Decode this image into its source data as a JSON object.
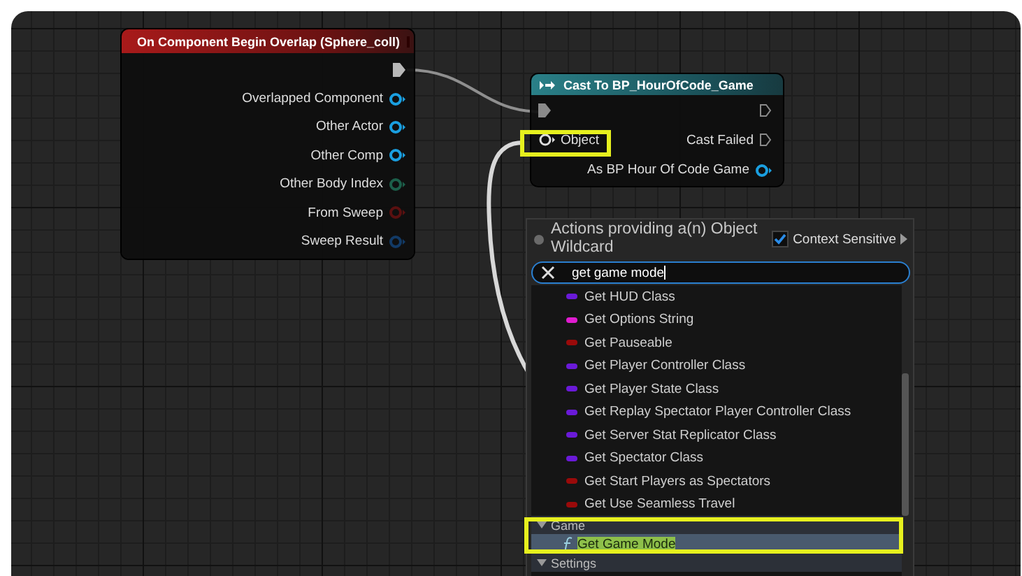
{
  "event_node": {
    "title": "On Component Begin Overlap (Sphere_coll)",
    "pins": [
      {
        "label": "Overlapped Component",
        "color": "#1a9fe0",
        "connected": false
      },
      {
        "label": "Other Actor",
        "color": "#1a9fe0",
        "connected": false
      },
      {
        "label": "Other Comp",
        "color": "#1a9fe0",
        "connected": false
      },
      {
        "label": "Other Body Index",
        "color": "#1c5f4a",
        "connected": false
      },
      {
        "label": "From Sweep",
        "color": "#5a1010",
        "connected": false
      },
      {
        "label": "Sweep Result",
        "color": "#123a66",
        "connected": false
      }
    ]
  },
  "cast_node": {
    "title": "Cast To BP_HourOfCode_Game",
    "input_pin": {
      "label": "Object",
      "connected": true
    },
    "outputs": [
      {
        "label": "Cast Failed",
        "kind": "exec"
      },
      {
        "label": "As BP Hour Of Code Game",
        "kind": "object"
      }
    ]
  },
  "action_menu": {
    "title": "Actions providing a(n) Object Wildcard",
    "context_sensitive": {
      "label": "Context Sensitive",
      "checked": true
    },
    "search": {
      "value": "get game mode"
    },
    "items": [
      {
        "label": "Get HUD Class",
        "color": "#6a1ad8"
      },
      {
        "label": "Get Options String",
        "color": "#e01cd0"
      },
      {
        "label": "Get Pauseable",
        "color": "#9a0a0a"
      },
      {
        "label": "Get Player Controller Class",
        "color": "#6a1ad8"
      },
      {
        "label": "Get Player State Class",
        "color": "#6a1ad8"
      },
      {
        "label": "Get Replay Spectator Player Controller Class",
        "color": "#6a1ad8"
      },
      {
        "label": "Get Server Stat Replicator Class",
        "color": "#6a1ad8"
      },
      {
        "label": "Get Spectator Class",
        "color": "#6a1ad8"
      },
      {
        "label": "Get Start Players as Spectators",
        "color": "#9a0a0a"
      },
      {
        "label": "Get Use Seamless Travel",
        "color": "#9a0a0a"
      }
    ],
    "categories": [
      {
        "label": "Game",
        "expanded": true,
        "items": [
          {
            "label": "Get Game Mode",
            "selected": true
          }
        ]
      },
      {
        "label": "Settings",
        "expanded": true
      }
    ]
  }
}
